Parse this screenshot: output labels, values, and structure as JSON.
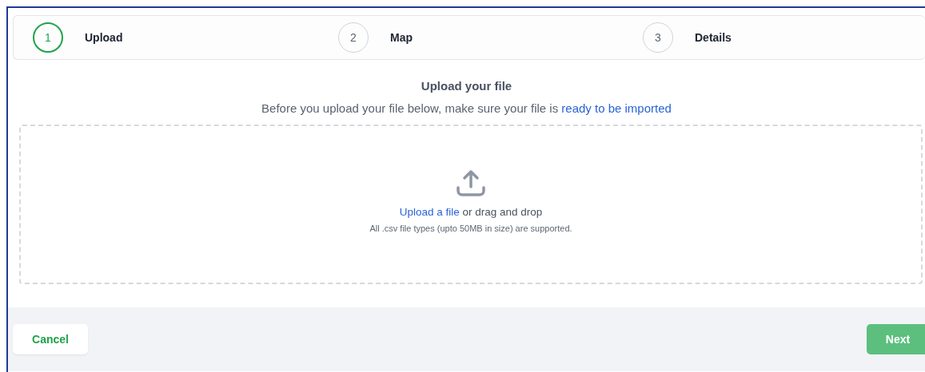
{
  "steps": [
    {
      "number": "1",
      "label": "Upload",
      "selected": true
    },
    {
      "number": "2",
      "label": "Map",
      "selected": false
    },
    {
      "number": "3",
      "label": "Details",
      "selected": false
    }
  ],
  "heading": "Upload your file",
  "intro": {
    "text": "Before you upload your file below, make sure your file is ",
    "link": "ready to be imported"
  },
  "dropzone": {
    "link": "Upload a file",
    "text": " or drag and drop",
    "hint": "All .csv file types (upto 50MB in size) are supported."
  },
  "footer": {
    "cancel": "Cancel",
    "next": "Next"
  }
}
